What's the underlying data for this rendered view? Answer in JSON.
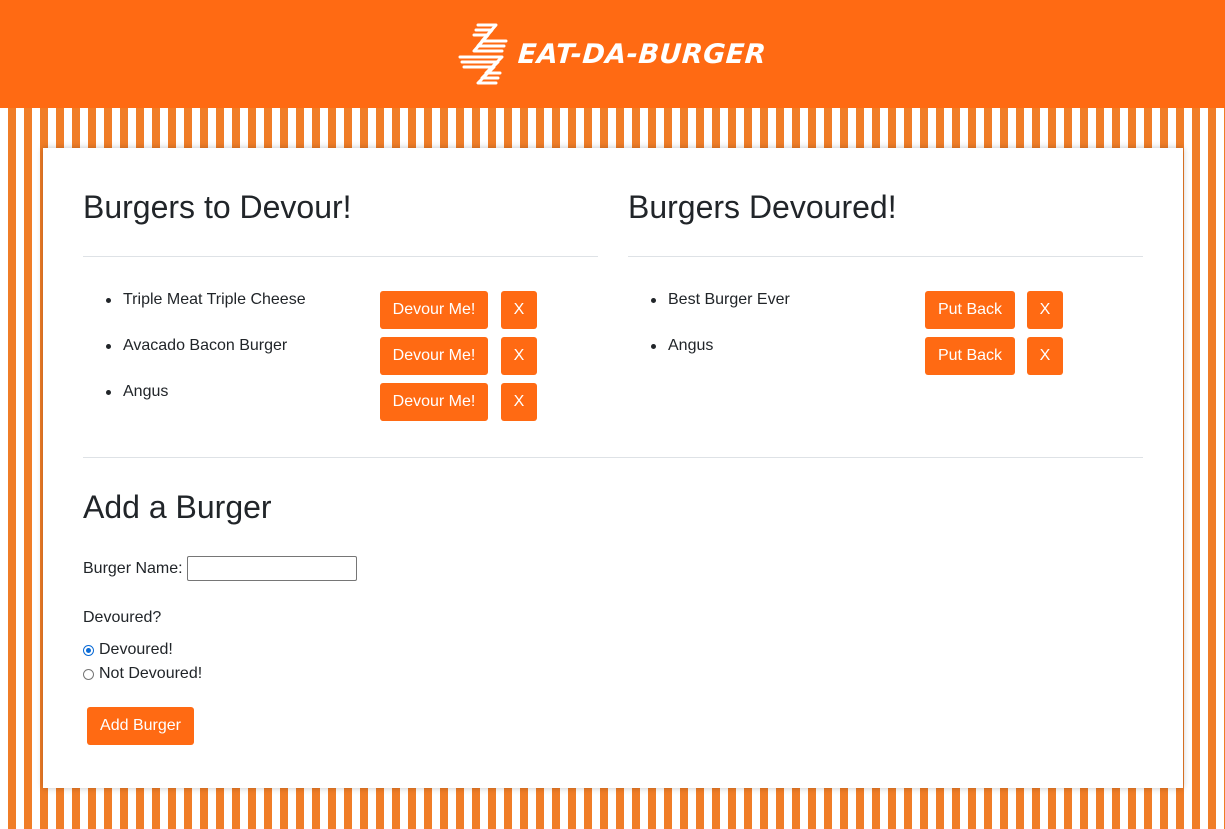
{
  "header": {
    "logo_text": "EAT-DA-BURGER"
  },
  "to_devour": {
    "title": "Burgers to Devour!",
    "action_label": "Devour Me!",
    "delete_label": "X",
    "items": [
      {
        "name": "Triple Meat Triple Cheese"
      },
      {
        "name": "Avacado Bacon Burger"
      },
      {
        "name": "Angus"
      }
    ]
  },
  "devoured": {
    "title": "Burgers Devoured!",
    "action_label": "Put Back",
    "delete_label": "X",
    "items": [
      {
        "name": "Best Burger Ever"
      },
      {
        "name": "Angus"
      }
    ]
  },
  "add_form": {
    "title": "Add a Burger",
    "name_label": "Burger Name:",
    "name_value": "",
    "devoured_question": "Devoured?",
    "options": [
      {
        "label": "Devoured!",
        "checked": true
      },
      {
        "label": "Not Devoured!",
        "checked": false
      }
    ],
    "submit_label": "Add Burger"
  },
  "colors": {
    "brand_orange": "#ff6a13",
    "stripe_orange": "#f07d27",
    "radio_blue": "#0b6bd6"
  }
}
